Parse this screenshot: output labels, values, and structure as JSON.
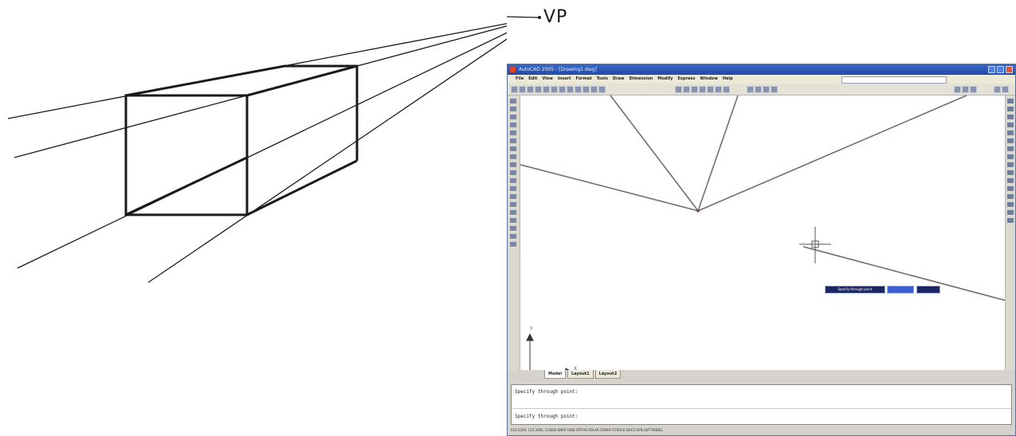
{
  "vp_label": "VP",
  "colors": {
    "box_stroke": "#1a1a1a",
    "cad_line": "#7a6a6a",
    "titlebar": "#2a58bc",
    "tooltip": "#1d2660"
  },
  "cad": {
    "title": "AutoCAD 2005 - [Drawing1.dwg]",
    "menu": [
      "File",
      "Edit",
      "View",
      "Insert",
      "Format",
      "Tools",
      "Draw",
      "Dimension",
      "Modify",
      "Express",
      "Window",
      "Help"
    ],
    "ucs": {
      "x": "X",
      "y": "Y"
    },
    "tooltip": [
      "Specify through point",
      "",
      ""
    ],
    "tabs": [
      "Model",
      "Layout1",
      "Layout2"
    ],
    "command_lines": [
      "Specify through point:",
      "Specify through point:"
    ],
    "status_text": "610.5249, 110.2681, 0.0000    SNAP  GRID  ORTHO  POLAR  OSNAP  OTRACK  DUCS  DYN  LWT  MODEL"
  }
}
